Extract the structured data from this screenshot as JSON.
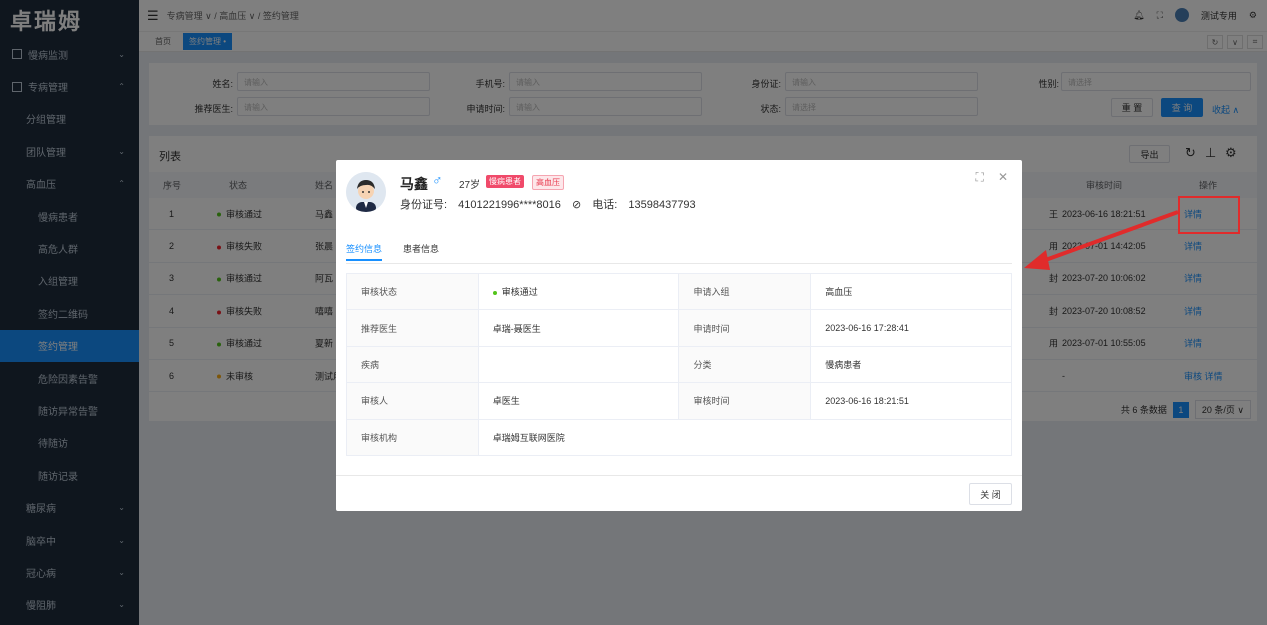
{
  "app": {
    "logo": "卓瑞姆"
  },
  "sidebar": {
    "items": [
      {
        "label": "慢病监测",
        "level": 0,
        "icon": "square-icon",
        "chevron": "⌄"
      },
      {
        "label": "专病管理",
        "level": 0,
        "icon": "square-icon",
        "chevron": "⌃"
      },
      {
        "label": "分组管理",
        "level": 1,
        "chevron": ""
      },
      {
        "label": "团队管理",
        "level": 1,
        "chevron": "⌄"
      },
      {
        "label": "高血压",
        "level": 1,
        "chevron": "⌃"
      },
      {
        "label": "慢病患者",
        "level": 2,
        "chevron": ""
      },
      {
        "label": "高危人群",
        "level": 2,
        "chevron": ""
      },
      {
        "label": "入组管理",
        "level": 2,
        "chevron": ""
      },
      {
        "label": "签约二维码",
        "level": 2,
        "chevron": ""
      },
      {
        "label": "签约管理",
        "level": 2,
        "chevron": "",
        "active": true
      },
      {
        "label": "危险因素告警",
        "level": 2,
        "chevron": ""
      },
      {
        "label": "随访异常告警",
        "level": 2,
        "chevron": ""
      },
      {
        "label": "待随访",
        "level": 2,
        "chevron": ""
      },
      {
        "label": "随访记录",
        "level": 2,
        "chevron": ""
      },
      {
        "label": "糖尿病",
        "level": 1,
        "chevron": "⌄"
      },
      {
        "label": "脑卒中",
        "level": 1,
        "chevron": "⌄"
      },
      {
        "label": "冠心病",
        "level": 1,
        "chevron": "⌄"
      },
      {
        "label": "慢阻肺",
        "level": 1,
        "chevron": "⌄"
      }
    ]
  },
  "topbar": {
    "breadcrumb": "专病管理 ∨  /  高血压 ∨  /  签约管理",
    "user": "测试专用"
  },
  "tabs": {
    "home": "首页",
    "current": "签约管理 •"
  },
  "filter": {
    "name_label": "姓名:",
    "name_ph": "请输入",
    "phone_label": "手机号:",
    "phone_ph": "请输入",
    "idcard_label": "身份证:",
    "idcard_ph": "请输入",
    "gender_label": "性别:",
    "gender_ph": "请选择",
    "doctor_label": "推荐医生:",
    "doctor_ph": "请输入",
    "apply_label": "申请时间:",
    "apply_ph": "请输入",
    "status_label": "状态:",
    "status_ph": "请选择",
    "reset": "重 置",
    "search": "查 询",
    "collapse": "收起 ∧"
  },
  "table": {
    "title": "列表",
    "export": "导出",
    "headers": {
      "index": "序号",
      "status": "状态",
      "name": "姓名",
      "review_time": "审核时间",
      "action": "操作"
    },
    "rows": [
      {
        "index": "1",
        "status": "审核通过",
        "status_color": "#52c41a",
        "name": "马鑫",
        "col_x": "王",
        "review_time": "2023-06-16 18:21:51",
        "action": "详情"
      },
      {
        "index": "2",
        "status": "审核失败",
        "status_color": "#f5222d",
        "name": "张晨",
        "col_x": "用",
        "review_time": "2023-07-01 14:42:05",
        "action": "详情"
      },
      {
        "index": "3",
        "status": "审核通过",
        "status_color": "#52c41a",
        "name": "阿瓦",
        "col_x": "封",
        "review_time": "2023-07-20 10:06:02",
        "action": "详情"
      },
      {
        "index": "4",
        "status": "审核失败",
        "status_color": "#f5222d",
        "name": "嘻嘻",
        "col_x": "封",
        "review_time": "2023-07-20 10:08:52",
        "action": "详情"
      },
      {
        "index": "5",
        "status": "审核通过",
        "status_color": "#52c41a",
        "name": "夏新",
        "col_x": "用",
        "review_time": "2023-07-01 10:55:05",
        "action": "详情"
      },
      {
        "index": "6",
        "status": "未审核",
        "status_color": "#faad14",
        "name": "测试用",
        "col_x": "",
        "review_time": "-",
        "action": "审核  详情"
      }
    ],
    "total": "共 6 条数据",
    "page": "1",
    "page_size": "20 条/页 ∨"
  },
  "modal": {
    "name": "马鑫",
    "gender_symbol": "♂",
    "age": "27岁",
    "tag1": "慢病患者",
    "tag2": "高血压",
    "id_label": "身份证号:",
    "id_value": "4101221996****8016",
    "phone_label": "电话:",
    "phone_value": "13598437793",
    "tab_sign": "签约信息",
    "tab_patient": "患者信息",
    "info": {
      "review_status_k": "审核状态",
      "review_status_v": "审核通过",
      "group_k": "申请入组",
      "group_v": "高血压",
      "doctor_k": "推荐医生",
      "doctor_v": "卓瑞-聂医生",
      "apply_time_k": "申请时间",
      "apply_time_v": "2023-06-16 17:28:41",
      "disease_k": "疾病",
      "disease_v": "",
      "category_k": "分类",
      "category_v": "慢病患者",
      "reviewer_k": "审核人",
      "reviewer_v": "卓医生",
      "review_time_k": "审核时间",
      "review_time_v": "2023-06-16 18:21:51",
      "org_k": "审核机构",
      "org_v": "卓瑞姆互联网医院"
    },
    "close": "关 闭"
  },
  "colors": {
    "primary": "#1890ff",
    "sidebar": "#1f2d3d",
    "annotation": "#e02b2b"
  }
}
